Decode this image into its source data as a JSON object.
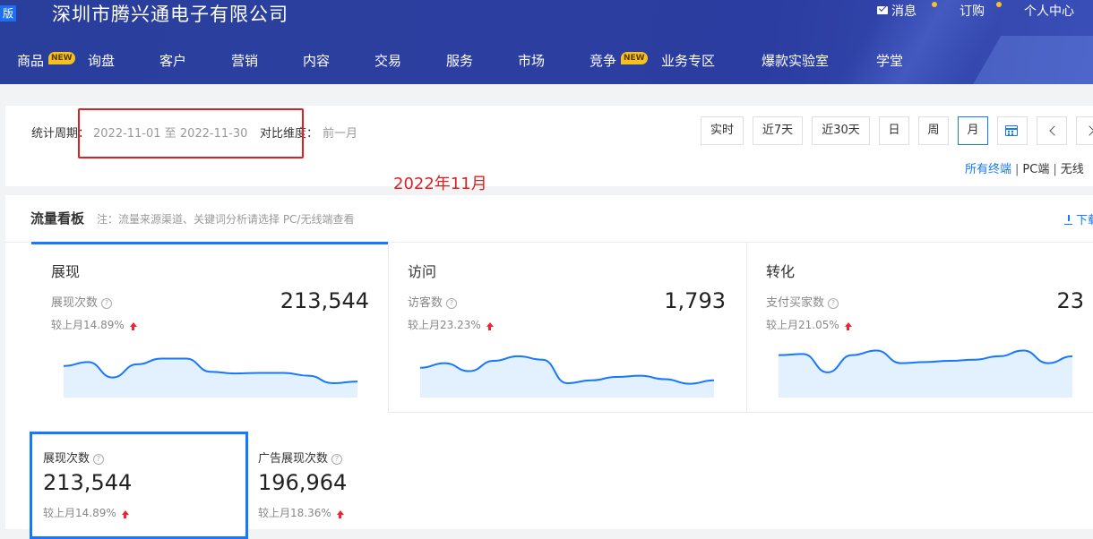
{
  "header": {
    "brand_tag": "版",
    "company_name": "深圳市腾兴通电子有限公司",
    "top_links": {
      "messages": "消息",
      "subscribe": "订购",
      "personal_center": "个人中心"
    },
    "nav": [
      {
        "label": "商品",
        "badge": "NEW"
      },
      {
        "label": "询盘"
      },
      {
        "label": "客户"
      },
      {
        "label": "营销"
      },
      {
        "label": "内容"
      },
      {
        "label": "交易"
      },
      {
        "label": "服务"
      },
      {
        "label": "市场"
      },
      {
        "label": "竞争",
        "badge": "NEW"
      },
      {
        "label": "业务专区"
      },
      {
        "label": "爆款实验室"
      },
      {
        "label": "学堂"
      }
    ],
    "colors": {
      "background": "#2b3da0",
      "badge": "#f5c11d"
    }
  },
  "period": {
    "period_label": "统计周期：",
    "period_value": "2022-11-01 至 2022-11-30",
    "compare_label": "对比维度：",
    "compare_value": "前一月",
    "annotation": "2022年11月",
    "buttons": [
      "实时",
      "近7天",
      "近30天",
      "日",
      "周",
      "月"
    ],
    "active_button": "月",
    "icons": {
      "calendar": "calendar-icon",
      "prev": "chevron-left-icon",
      "next": "chevron-right-icon"
    },
    "terminal_options": [
      "所有终端",
      "PC端",
      "无线"
    ],
    "active_terminal": "所有终端"
  },
  "board": {
    "title": "流量看板",
    "note": "注：流量来源渠道、关键词分析请选择 PC/无线端查看",
    "download_label": "下载",
    "cards": [
      {
        "title": "展现",
        "metric_label": "展现次数",
        "value": "213,544",
        "compare": "较上月14.89%",
        "trend": [
          0.55,
          0.62,
          0.35,
          0.58,
          0.68,
          0.68,
          0.45,
          0.42,
          0.43,
          0.43,
          0.38,
          0.25,
          0.28
        ]
      },
      {
        "title": "访问",
        "metric_label": "访客数",
        "value": "1,793",
        "compare": "较上月23.23%",
        "trend": [
          0.52,
          0.6,
          0.46,
          0.64,
          0.72,
          0.66,
          0.25,
          0.3,
          0.36,
          0.38,
          0.32,
          0.24,
          0.3
        ]
      },
      {
        "title": "转化",
        "metric_label": "支付买家数",
        "value": "23",
        "compare": "较上月21.05%",
        "trend": [
          0.74,
          0.76,
          0.44,
          0.74,
          0.82,
          0.6,
          0.62,
          0.64,
          0.66,
          0.72,
          0.82,
          0.6,
          0.72
        ]
      }
    ],
    "detail_cards": [
      {
        "title": "展现次数",
        "value": "213,544",
        "compare": "较上月14.89%",
        "selected": true
      },
      {
        "title": "广告展现次数",
        "value": "196,964",
        "compare": "较上月18.36%",
        "selected": false
      }
    ],
    "colors": {
      "accent": "#1677ff",
      "up": "#f5222d",
      "spark_fill": "#e3f0fd",
      "spark_line": "#1677ff"
    }
  }
}
